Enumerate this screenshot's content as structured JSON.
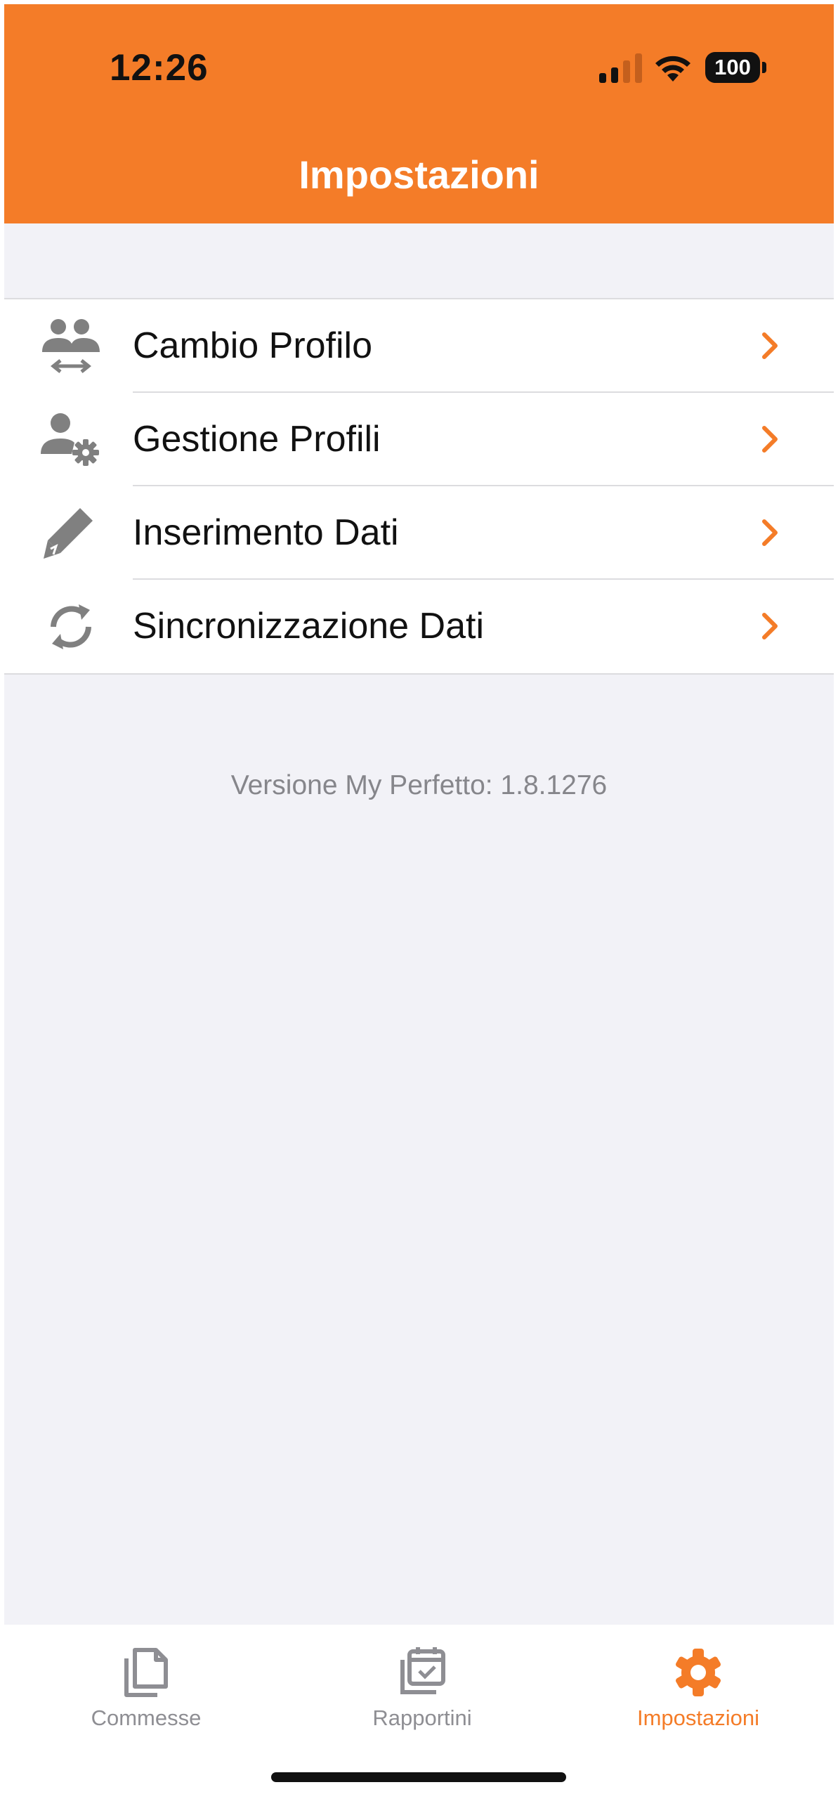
{
  "status_bar": {
    "time": "12:26",
    "battery": "100"
  },
  "header": {
    "title": "Impostazioni"
  },
  "menu": [
    {
      "label": "Cambio Profilo",
      "icon": "switch-profile-icon"
    },
    {
      "label": "Gestione Profili",
      "icon": "manage-profiles-icon"
    },
    {
      "label": "Inserimento Dati",
      "icon": "pencil-icon"
    },
    {
      "label": "Sincronizzazione Dati",
      "icon": "sync-icon"
    }
  ],
  "version_text": "Versione My Perfetto: 1.8.1276",
  "tabs": [
    {
      "label": "Commesse",
      "icon": "documents-icon",
      "active": false
    },
    {
      "label": "Rapportini",
      "icon": "calendar-check-icon",
      "active": false
    },
    {
      "label": "Impostazioni",
      "icon": "gear-icon",
      "active": true
    }
  ],
  "colors": {
    "accent": "#f47c28",
    "icon_gray": "#808080",
    "background": "#f2f2f7"
  }
}
